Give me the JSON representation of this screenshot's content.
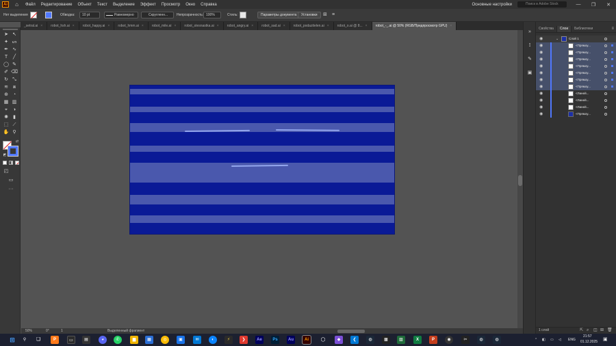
{
  "menubar": {
    "app_logo": "Ai",
    "items": [
      "Файл",
      "Редактирование",
      "Объект",
      "Текст",
      "Выделение",
      "Эффект",
      "Просмотр",
      "Окно",
      "Справка"
    ],
    "workspace": "Основные настройки",
    "search_placeholder": "Поиск в Adobe Stock"
  },
  "controlbar": {
    "selection_state": "Нет выделения",
    "stroke_label": "Обводка:",
    "stroke_value": "10 pt",
    "profile": "Равномерно",
    "brush": "Скругленн...",
    "opacity_label": "Непрозрачность:",
    "opacity_value": "100%",
    "style_label": "Стиль:",
    "doc_settings": "Параметры документа",
    "preferences": "Установки"
  },
  "tabs": [
    {
      "label": "_setral.ai",
      "active": false
    },
    {
      "label": "robot_hsh.ai",
      "active": false
    },
    {
      "label": "robot_happy.ai",
      "active": false
    },
    {
      "label": "robot_hmm.ai",
      "active": false
    },
    {
      "label": "robot_mile.ai",
      "active": false
    },
    {
      "label": "robot_stesnastka.ai",
      "active": false
    },
    {
      "label": "robot_angry.ai",
      "active": false
    },
    {
      "label": "robot_sad.ai",
      "active": false
    },
    {
      "label": "robot_podazitelen.ai",
      "active": false
    },
    {
      "label": "robot_o.ai @ 8...",
      "active": false
    },
    {
      "label": "robot_-_.ai @ 50% (RGB/Предпросмотр GPU)",
      "active": true
    }
  ],
  "statusbar": {
    "zoom": "50%",
    "rotation": "0°",
    "artboard": "1",
    "tool_hint": "Выделенный фрагмент"
  },
  "panel": {
    "tabs": [
      "Свойства",
      "Слои",
      "Библиотеки"
    ],
    "active_tab": "Слои",
    "root_layer": "Слой 1",
    "rows": [
      {
        "name": "<Прямоу...",
        "selected": true,
        "thumb": "white"
      },
      {
        "name": "<Прямоу...",
        "selected": true,
        "thumb": "white"
      },
      {
        "name": "<Прямоу...",
        "selected": true,
        "thumb": "white"
      },
      {
        "name": "<Прямоу...",
        "selected": true,
        "thumb": "white"
      },
      {
        "name": "<Прямоу...",
        "selected": true,
        "thumb": "white"
      },
      {
        "name": "<Прямоу...",
        "selected": true,
        "thumb": "white"
      },
      {
        "name": "<Прямоу...",
        "selected": true,
        "thumb": "white"
      },
      {
        "name": "<Линей...",
        "selected": false,
        "thumb": "white"
      },
      {
        "name": "<Линей...",
        "selected": false,
        "thumb": "white"
      },
      {
        "name": "<Линей...",
        "selected": false,
        "thumb": "white"
      },
      {
        "name": "<Прямоу...",
        "selected": false,
        "thumb": "blue"
      }
    ],
    "footer": "1 слой"
  },
  "taskbar": {
    "apps": [
      "Ae",
      "Ps",
      "Au",
      "Ai"
    ],
    "language": "ENG",
    "time": "21:57",
    "date": "01.12.2025"
  },
  "colors": {
    "artboard": "#0a1a96",
    "stripe": "#4a58ad",
    "line": "#93a6ee",
    "selection_accent": "#5078ff",
    "ai_orange": "#ff9a00"
  }
}
